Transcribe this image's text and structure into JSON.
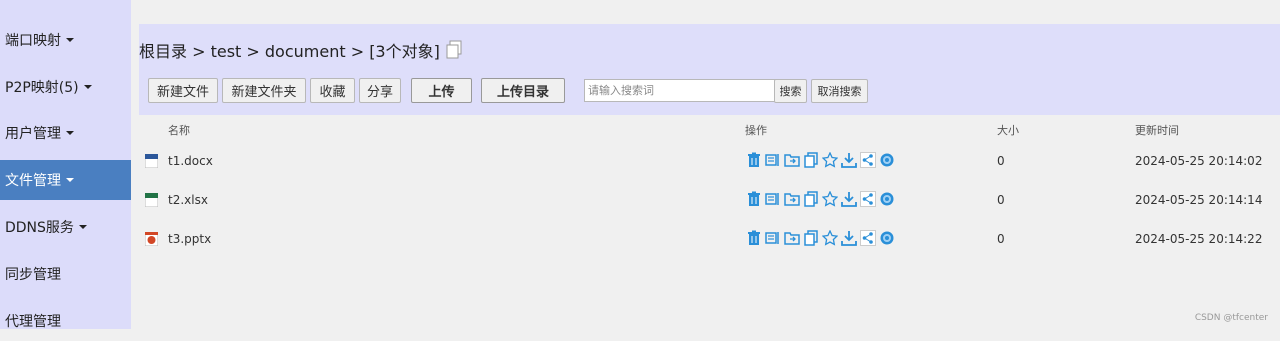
{
  "sidebar": {
    "items": [
      {
        "label": "端口映射",
        "caret": true,
        "active": false
      },
      {
        "label": "P2P映射(5)",
        "caret": true,
        "active": false
      },
      {
        "label": "用户管理",
        "caret": true,
        "active": false
      },
      {
        "label": "文件管理",
        "caret": true,
        "active": true
      },
      {
        "label": "DDNS服务",
        "caret": true,
        "active": false
      },
      {
        "label": "同步管理",
        "caret": false,
        "active": false
      },
      {
        "label": "代理管理",
        "caret": false,
        "active": false
      }
    ]
  },
  "breadcrumb": "根目录 > test > document > [3个对象]",
  "toolbar": {
    "new_file": "新建文件",
    "new_folder": "新建文件夹",
    "favorite": "收藏",
    "share": "分享",
    "upload": "上传",
    "upload_dir": "上传目录",
    "search_placeholder": "请输入搜索词",
    "search": "搜索",
    "cancel_search": "取消搜索"
  },
  "table": {
    "headers": {
      "name": "名称",
      "ops": "操作",
      "size": "大小",
      "modified": "更新时间"
    },
    "rows": [
      {
        "name": "t1.docx",
        "icon": "word-file-icon",
        "size": "0",
        "modified": "2024-05-25 20:14:02"
      },
      {
        "name": "t2.xlsx",
        "icon": "excel-file-icon",
        "size": "0",
        "modified": "2024-05-25 20:14:14"
      },
      {
        "name": "t3.pptx",
        "icon": "powerpoint-file-icon",
        "size": "0",
        "modified": "2024-05-25 20:14:22"
      }
    ],
    "op_icons": [
      "delete-icon",
      "rename-icon",
      "move-icon",
      "copy-icon",
      "favorite-icon",
      "download-icon",
      "share-icon",
      "settings-icon"
    ]
  },
  "colors": {
    "sidebar_bg": "#dcdcfa",
    "active_bg": "#4a7fc1",
    "header_bg": "#dedefa",
    "icon_blue": "#2a8fd8"
  },
  "watermark": "CSDN @tfcenter"
}
